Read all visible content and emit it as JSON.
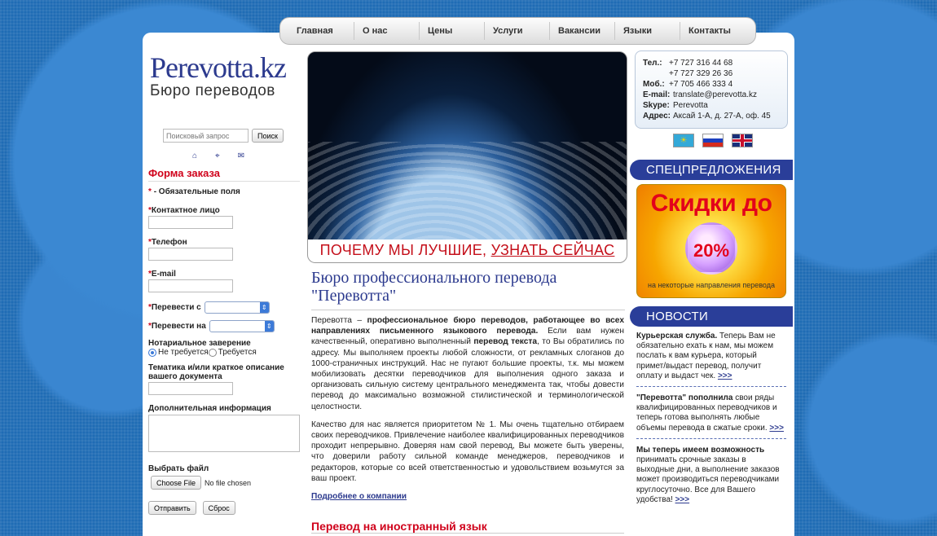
{
  "nav": [
    "Главная",
    "О нас",
    "Цены",
    "Услуги",
    "Вакансии",
    "Языки",
    "Контакты"
  ],
  "logo": {
    "brand": "Perevotta.kz",
    "sub": "Бюро переводов"
  },
  "search": {
    "placeholder": "Поисковый запрос",
    "button": "Поиск"
  },
  "order_form": {
    "title": "Форма заказа",
    "required_note": "- Обязательные поля",
    "contact_label": "Контактное лицо",
    "phone_label": "Телефон",
    "email_label": "E-mail",
    "from_label": "Перевести с",
    "to_label": "Перевести на",
    "notary_label": "Нотариальное заверение",
    "notary_opt1": "Не требуется",
    "notary_opt2": "Требуется",
    "topic_label": "Тематика и/или краткое описание вашего документа",
    "extra_label": "Дополнительная информация",
    "file_label": "Выбрать файл",
    "file_button": "Choose File",
    "file_status": "No file chosen",
    "submit": "Отправить",
    "reset": "Сброс"
  },
  "banner": {
    "caption_part1": "ПОЧЕМУ МЫ ЛУЧШИЕ, ",
    "caption_part2": "УЗНАТЬ СЕЙЧАС"
  },
  "main": {
    "title": "Бюро профессионального перевода \"Перевотта\"",
    "p1_a": "Перевотта – ",
    "p1_bold": "профессиональное бюро переводов, работающее во всех направлениях письменного языкового перевода.",
    "p1_b": " Если вам нужен качественный, оперативно выполненный ",
    "p1_bold2": "перевод текста",
    "p1_c": ", то Вы обратились по адресу. Мы выполняем проекты любой сложности, от рекламных слоганов до 1000-страничных инструкций. Нас не пугают большие проекты, т.к. мы можем мобилизовать десятки переводчиков для выполнения одного заказа и организовать сильную систему центрального менеджмента так, чтобы довести перевод до максимально возможной стилистической и терминологической целостности.",
    "p2": "Качество для нас является приоритетом № 1. Мы очень тщательно отбираем своих переводчиков. Привлечение наиболее квалифицированных переводчиков проходит непрерывно. Доверяя нам свой перевод, Вы можете быть уверены, что доверили работу сильной команде менеджеров, переводчиков и редакторов, которые со всей ответственностью и удовольствием возьмутся за ваш проект.",
    "more": "Подробнее о компании",
    "section2": "Перевод на иностранный язык"
  },
  "contacts": {
    "tel_label": "Тел.:",
    "tel1": "+7 727 316 44 68",
    "tel2": "+7 727 329 26 36",
    "mob_label": "Моб.:",
    "mob": "+7 705 466 333 4",
    "email_label": "E-mail:",
    "email": "translate@perevotta.kz",
    "skype_label": "Skype:",
    "skype": "Perevotta",
    "addr_label": "Адрес:",
    "addr": "Аксай 1-А, д. 27-А, оф. 45"
  },
  "special": {
    "band": "СПЕЦПРЕДЛОЖЕНИЯ",
    "promo_big": "Скидки до",
    "promo_pct": "20%",
    "promo_small": "на некоторые направления перевода"
  },
  "news": {
    "band": "НОВОСТИ",
    "n1_bold": "Курьерская служба.",
    "n1_text": " Теперь Вам не обязательно ехать к нам, мы можем послать к вам курьера, который примет/выдаст перевод, получит оплату и выдаст чек. ",
    "n2_bold": "\"Перевотта\" пополнила",
    "n2_text": " свои ряды квалифицированных переводчиков и теперь готова выполнять любые объемы перевода в сжатые сроки. ",
    "n3_bold": "Мы теперь имеем возможность",
    "n3_text": " принимать срочные заказы в выходные дни, а выполнение заказов может производиться переводчиками круглосуточно. Все для Вашего удобства! ",
    "more": ">>>"
  },
  "icons": {
    "home": "home-icon",
    "sitemap": "sitemap-icon",
    "mail": "mail-icon"
  }
}
